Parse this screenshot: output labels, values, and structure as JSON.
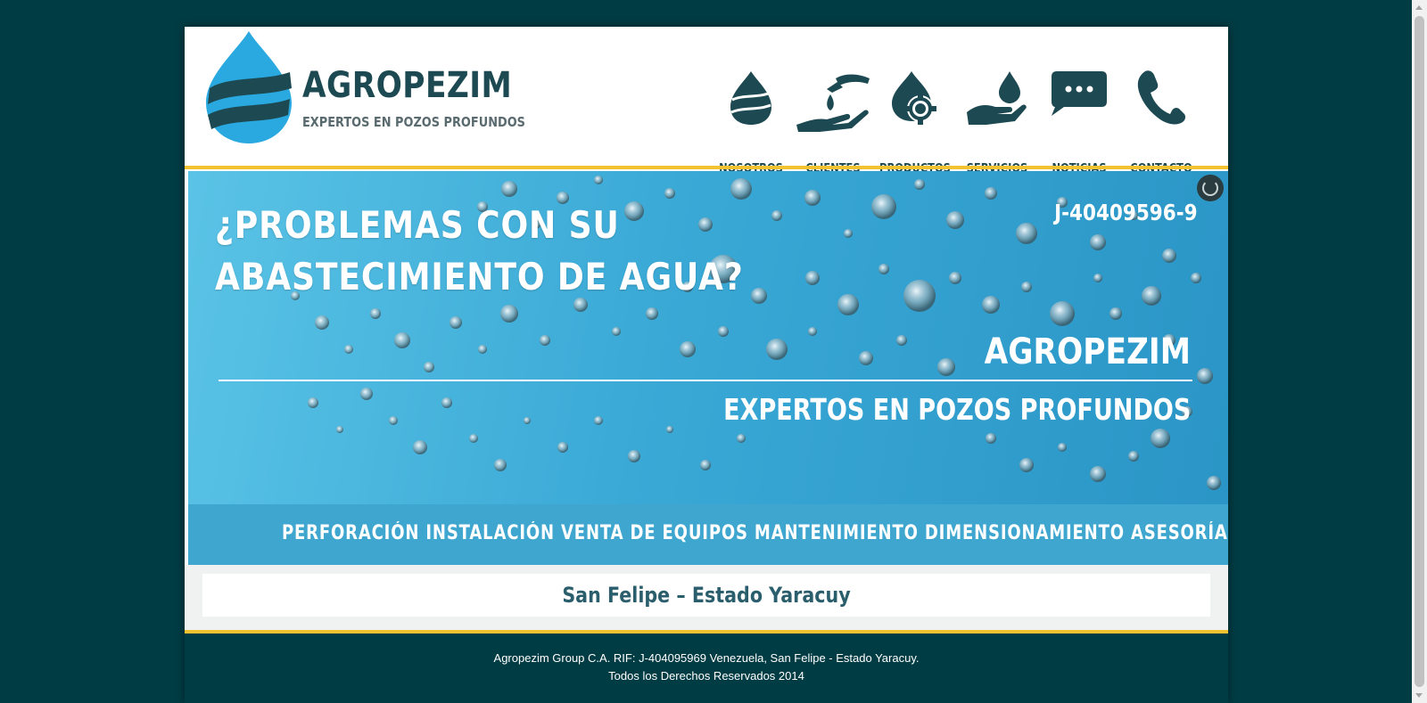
{
  "header": {
    "brand_name": "AGROPEZIM",
    "brand_tagline": "EXPERTOS EN POZOS PROFUNDOS"
  },
  "nav": {
    "items": [
      {
        "label": "NOSOTROS",
        "icon": "water-drop-icon"
      },
      {
        "label": "CLIENTES",
        "icon": "hands-exchange-icon"
      },
      {
        "label": "PRODUCTOS",
        "icon": "drop-gear-icon"
      },
      {
        "label": "SERVICIOS",
        "icon": "hand-drop-icon"
      },
      {
        "label": "NOTICIAS",
        "icon": "chat-bubble-icon"
      },
      {
        "label": "CONTACTO",
        "icon": "phone-icon"
      }
    ]
  },
  "banner": {
    "headline_line1": "¿PROBLEMAS CON SU",
    "headline_line2": "ABASTECIMIENTO DE AGUA?",
    "rif": "J-40409596-9",
    "brand": "AGROPEZIM",
    "slogan": "EXPERTOS EN POZOS PROFUNDOS",
    "services": "PERFORACIÓN INSTALACIÓN VENTA DE EQUIPOS MANTENIMIENTO DIMENSIONAMIENTO ASESORÍA"
  },
  "location": {
    "text": "San Felipe – Estado Yaracuy"
  },
  "footer": {
    "line1": "Agropezim Group C.A. RIF: J-404095969 Venezuela, San Felipe - Estado Yaracuy.",
    "line2": "Todos los Derechos Reservados 2014"
  },
  "colors": {
    "page_background": "#003c44",
    "brand_dark": "#1d4a52",
    "brand_blue": "#29a9e0",
    "accent_gold": "#f2c230"
  }
}
